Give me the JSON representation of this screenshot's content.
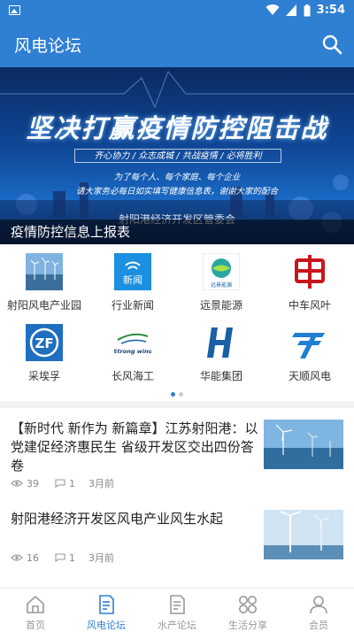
{
  "status_bar": {
    "time": "3:54"
  },
  "app_bar": {
    "title": "风电论坛",
    "search_icon": "search-icon"
  },
  "banner": {
    "headline": "坚决打赢疫情防控阻击战",
    "slogan": "齐心协力 / 众志成城 / 共战疫情 / 必将胜利",
    "line1": "为了每个人、每个家庭、每个企业",
    "line2": "请大家务必每日如实填写健康信息表，谢谢大家的配合",
    "org": "射阳港经济开发区管委会",
    "caption": "疫情防控信息上报表"
  },
  "categories": [
    {
      "label": "射阳风电产业园",
      "icon": "wind-farm-photo-icon"
    },
    {
      "label": "行业新闻",
      "icon": "news-icon"
    },
    {
      "label": "远景能源",
      "icon": "envision-logo-icon"
    },
    {
      "label": "中车风叶",
      "icon": "crrc-logo-icon"
    },
    {
      "label": "采埃孚",
      "icon": "zf-logo-icon"
    },
    {
      "label": "长风海工",
      "icon": "strong-wind-logo-icon",
      "logo_text": "Strong wind"
    },
    {
      "label": "华能集团",
      "icon": "huaneng-logo-icon"
    },
    {
      "label": "天顺风电",
      "icon": "titan-logo-icon"
    }
  ],
  "carousel": {
    "pages": 2,
    "active": 1
  },
  "news_logo_text": "新闻",
  "envision_logo_text": "远景能源",
  "zf_logo_text": "ZF",
  "articles": [
    {
      "title": "【新时代 新作为 新篇章】江苏射阳港：以党建促经济惠民生 省级开发区交出四份答卷",
      "views": "39",
      "comments": "1",
      "time": "3月前"
    },
    {
      "title": "射阳港经济开发区风电产业风生水起",
      "views": "16",
      "comments": "1",
      "time": "3月前"
    }
  ],
  "tabs": [
    {
      "label": "首页",
      "icon": "home-icon"
    },
    {
      "label": "风电论坛",
      "icon": "forum-doc-icon",
      "active": true
    },
    {
      "label": "水产论坛",
      "icon": "doc-icon"
    },
    {
      "label": "生活分享",
      "icon": "grid-circles-icon"
    },
    {
      "label": "会员",
      "icon": "person-icon"
    }
  ],
  "colors": {
    "primary": "#2f7fd3",
    "tab_inactive": "#999999"
  }
}
